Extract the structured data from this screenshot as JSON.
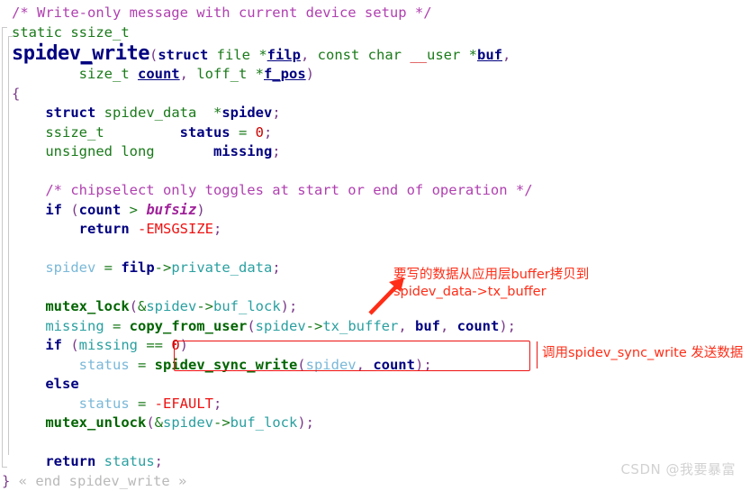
{
  "document": {
    "kind": "source-code-listing",
    "language": "C",
    "function_name": "spidev_write",
    "background_color": "#ffffff"
  },
  "palette": {
    "comment": "#b040b0",
    "keyword": "#000080",
    "type": "#1a7a1a",
    "function": "#006400",
    "identifier": "#2a9fa0",
    "identifier_light": "#7ab8d8",
    "number": "#cc0000",
    "macro": "#ee1111",
    "annotation": "#ff2d17",
    "fold_guide": "#c9c9c9",
    "watermark": "#d2d2d2"
  },
  "code": {
    "lines": [
      "/* Write-only message with current device setup */",
      "static ssize_t",
      "spidev_write(struct file *filp, const char __user *buf,",
      "        size_t count, loff_t *f_pos)",
      "{",
      "    struct spidev_data  *spidev;",
      "    ssize_t         status = 0;",
      "    unsigned long       missing;",
      "",
      "    /* chipselect only toggles at start or end of operation */",
      "    if (count > bufsiz)",
      "        return -EMSGSIZE;",
      "",
      "    spidev = filp->private_data;",
      "",
      "    mutex_lock(&spidev->buf_lock);",
      "    missing = copy_from_user(spidev->tx_buffer, buf, count);",
      "    if (missing == 0)",
      "        status = spidev_sync_write(spidev, count);",
      "    else",
      "        status = -EFAULT;",
      "    mutex_unlock(&spidev->buf_lock);",
      "",
      "    return status;",
      "} « end spidev_write »"
    ],
    "comments": [
      "/* Write-only message with current device setup */",
      "/* chipselect only toggles at start or end of operation */"
    ],
    "fold_end_marker": "« end spidev_write »"
  },
  "annotations": {
    "copy_from_user_note": {
      "line1": "要写的数据从应用层buffer拷贝到",
      "line2": "spidev_data->tx_buffer",
      "color": "#ff2d17",
      "has_arrow": true,
      "arrow_direction": "up-right"
    },
    "sync_write_note": {
      "text": "调用spidev_sync_write 发送数据",
      "color": "#ff2d17",
      "bracket": "left-vertical-rule"
    },
    "highlight_box": {
      "target_text": "spidev_sync_write(spidev, count);",
      "border_color": "#ee1111"
    }
  },
  "watermark": {
    "text": "CSDN @我要暴富"
  }
}
